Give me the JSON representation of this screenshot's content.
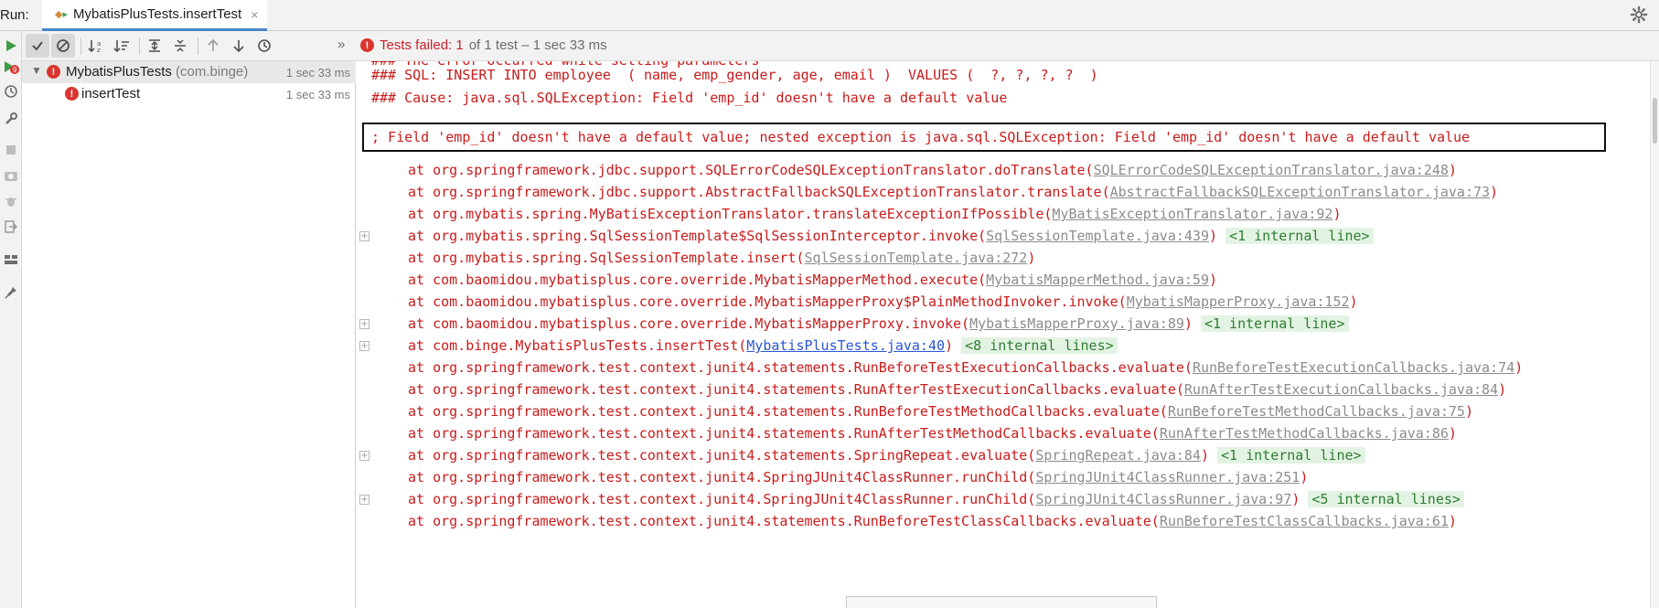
{
  "run": {
    "label": "Run:",
    "tab_title": "MybatisPlusTests.insertTest",
    "tab_close": "×"
  },
  "toolbar": {
    "more": "»",
    "status_failed": "Tests failed: 1",
    "status_rest": "of 1 test – 1 sec 33 ms"
  },
  "tree": {
    "root": {
      "name": "MybatisPlusTests",
      "pkg": "(com.binge)",
      "time": "1 sec 33 ms"
    },
    "child": {
      "name": "insertTest",
      "time": "1 sec 33 ms"
    }
  },
  "console": {
    "line_cut": "### The error occurred while setting parameters",
    "line_sql": "### SQL: INSERT INTO employee  ( name, emp_gender, age, email )  VALUES (  ?, ?, ?, ?  )",
    "line_cause": "### Cause: java.sql.SQLException: Field 'emp_id' doesn't have a default value",
    "line_highlight": "; Field 'emp_id' doesn't have a default value; nested exception is java.sql.SQLException: Field 'emp_id' doesn't have a default value",
    "frames": [
      {
        "text": "at org.springframework.jdbc.support.SQLErrorCodeSQLExceptionTranslator.doTranslate(",
        "link": "SQLErrorCodeSQLExceptionTranslator.java:248",
        "end": ")",
        "internal": "",
        "fold": false,
        "blue": false
      },
      {
        "text": "at org.springframework.jdbc.support.AbstractFallbackSQLExceptionTranslator.translate(",
        "link": "AbstractFallbackSQLExceptionTranslator.java:73",
        "end": ")",
        "internal": "",
        "fold": false,
        "blue": false
      },
      {
        "text": "at org.mybatis.spring.MyBatisExceptionTranslator.translateExceptionIfPossible(",
        "link": "MyBatisExceptionTranslator.java:92",
        "end": ")",
        "internal": "",
        "fold": false,
        "blue": false
      },
      {
        "text": "at org.mybatis.spring.SqlSessionTemplate$SqlSessionInterceptor.invoke(",
        "link": "SqlSessionTemplate.java:439",
        "end": ")",
        "internal": "<1 internal line>",
        "fold": true,
        "blue": false
      },
      {
        "text": "at org.mybatis.spring.SqlSessionTemplate.insert(",
        "link": "SqlSessionTemplate.java:272",
        "end": ")",
        "internal": "",
        "fold": false,
        "blue": false
      },
      {
        "text": "at com.baomidou.mybatisplus.core.override.MybatisMapperMethod.execute(",
        "link": "MybatisMapperMethod.java:59",
        "end": ")",
        "internal": "",
        "fold": false,
        "blue": false
      },
      {
        "text": "at com.baomidou.mybatisplus.core.override.MybatisMapperProxy$PlainMethodInvoker.invoke(",
        "link": "MybatisMapperProxy.java:152",
        "end": ")",
        "internal": "",
        "fold": false,
        "blue": false
      },
      {
        "text": "at com.baomidou.mybatisplus.core.override.MybatisMapperProxy.invoke(",
        "link": "MybatisMapperProxy.java:89",
        "end": ")",
        "internal": "<1 internal line>",
        "fold": true,
        "blue": false
      },
      {
        "text": "at com.binge.MybatisPlusTests.insertTest(",
        "link": "MybatisPlusTests.java:40",
        "end": ")",
        "internal": "<8 internal lines>",
        "fold": true,
        "blue": true
      },
      {
        "text": "at org.springframework.test.context.junit4.statements.RunBeforeTestExecutionCallbacks.evaluate(",
        "link": "RunBeforeTestExecutionCallbacks.java:74",
        "end": ")",
        "internal": "",
        "fold": false,
        "blue": false
      },
      {
        "text": "at org.springframework.test.context.junit4.statements.RunAfterTestExecutionCallbacks.evaluate(",
        "link": "RunAfterTestExecutionCallbacks.java:84",
        "end": ")",
        "internal": "",
        "fold": false,
        "blue": false
      },
      {
        "text": "at org.springframework.test.context.junit4.statements.RunBeforeTestMethodCallbacks.evaluate(",
        "link": "RunBeforeTestMethodCallbacks.java:75",
        "end": ")",
        "internal": "",
        "fold": false,
        "blue": false
      },
      {
        "text": "at org.springframework.test.context.junit4.statements.RunAfterTestMethodCallbacks.evaluate(",
        "link": "RunAfterTestMethodCallbacks.java:86",
        "end": ")",
        "internal": "",
        "fold": false,
        "blue": false
      },
      {
        "text": "at org.springframework.test.context.junit4.statements.SpringRepeat.evaluate(",
        "link": "SpringRepeat.java:84",
        "end": ")",
        "internal": "<1 internal line>",
        "fold": true,
        "blue": false
      },
      {
        "text": "at org.springframework.test.context.junit4.SpringJUnit4ClassRunner.runChild(",
        "link": "SpringJUnit4ClassRunner.java:251",
        "end": ")",
        "internal": "",
        "fold": false,
        "blue": false
      },
      {
        "text": "at org.springframework.test.context.junit4.SpringJUnit4ClassRunner.runChild(",
        "link": "SpringJUnit4ClassRunner.java:97",
        "end": ")",
        "internal": "<5 internal lines>",
        "fold": true,
        "blue": false
      },
      {
        "text": "at org.springframework.test.context.junit4.statements.RunBeforeTestClassCallbacks.evaluate(",
        "link": "RunBeforeTestClassCallbacks.java:61",
        "end": ")",
        "internal": "",
        "fold": false,
        "blue": false
      }
    ]
  },
  "colors": {
    "error_red": "#c91b1b",
    "link_gray": "#8c8c8c",
    "link_blue": "#2a56d6",
    "internal_green": "#2e7d32"
  }
}
